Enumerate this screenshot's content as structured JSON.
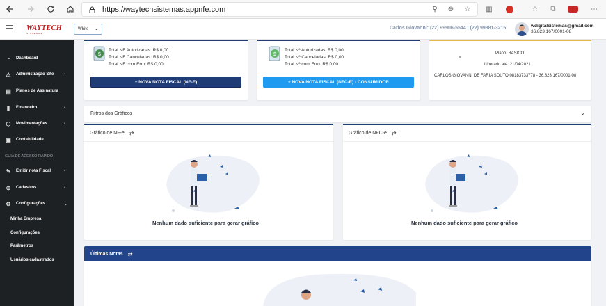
{
  "browser": {
    "url": "https://waytechsistemas.appnfe.com"
  },
  "header": {
    "logo_main": "WAYTECH",
    "logo_sub": "SISTEMAS",
    "theme_value": "White",
    "contact": "Carlos Giovanni: (22) 99906-5544 | (22) 99881-3215",
    "user_email": "wdigitalsistemas@gmail.com",
    "user_cnpj": "36.823.167/0001-08"
  },
  "sidebar": {
    "items": [
      {
        "label": "Dashboard",
        "icon": "dashboard-icon"
      },
      {
        "label": "Administração Site",
        "icon": "warning-icon"
      },
      {
        "label": "Planos de Assinatura",
        "icon": "list-icon"
      },
      {
        "label": "Financeiro",
        "icon": "chart-icon"
      },
      {
        "label": "Movimentações",
        "icon": "box-icon"
      },
      {
        "label": "Contabilidade",
        "icon": "book-icon"
      }
    ],
    "heading": "GUIA DE ACESSO RÁPIDO",
    "quick": [
      {
        "label": "Emitir nota Fiscal",
        "icon": "pen-icon"
      },
      {
        "label": "Cadastros",
        "icon": "plus-icon"
      },
      {
        "label": "Configurações",
        "icon": "gear-icon"
      }
    ],
    "sub_items": [
      "Minha Empresa",
      "Configurações",
      "Parâmetros",
      "Usuários cadastrados"
    ]
  },
  "nfe_card": {
    "authorized": "Total NF Autorizadas: R$ 0,00",
    "cancelled": "Total NF Canceladas:  R$ 0,00",
    "error": "Total NF com Erro:    R$ 0,00",
    "button": "+ NOVA NOTA FISCAL (NF-E)"
  },
  "nfce_card": {
    "authorized": "Total Nº Autorizadas: R$ 0,00",
    "cancelled": "Total Nº Canceladas:  R$ 0,00",
    "error": "Total Nº com Erro:    R$ 0,00",
    "button": "+ NOVA NOTA FISCAL (NFC-E) - CONSUMIDOR"
  },
  "plan_card": {
    "plan": "Plano: BASICO",
    "released": "Liberado até: 21/04/2021",
    "owner": "CARLOS GIOVANNI DE FARIA SOUTO 08183733778 - 36.823.167/0001-08"
  },
  "filters": {
    "title": "Filtros dos Gráficos"
  },
  "chart_nfe": {
    "title": "Gráfico de NF-e",
    "empty": "Nenhum dado suficiente para gerar gráfico"
  },
  "chart_nfce": {
    "title": "Gráfico de NFC-e",
    "empty": "Nenhum dado suficiente para gerar gráfico"
  },
  "notes": {
    "title": "Últimas Notas"
  },
  "colors": {
    "navy": "#1f3c77",
    "light_blue": "#1e9bf0",
    "sidebar": "#1e2124",
    "gold": "#e8b84a"
  }
}
